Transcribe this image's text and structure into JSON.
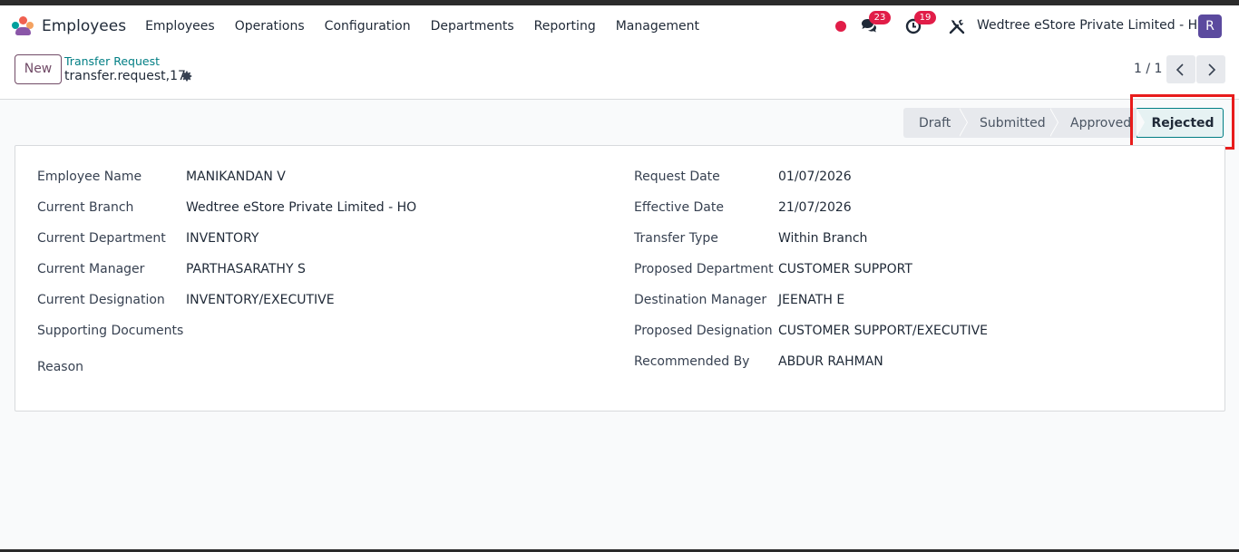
{
  "navbar": {
    "app_name": "Employees",
    "menu": [
      "Employees",
      "Operations",
      "Configuration",
      "Departments",
      "Reporting",
      "Management"
    ],
    "messages_count": "23",
    "activities_count": "19",
    "company": "Wedtree eStore Private Limited - HO",
    "avatar_letter": "R"
  },
  "control_panel": {
    "new_label": "New",
    "breadcrumb": "Transfer Request",
    "record_name": "transfer.request,17",
    "pager": "1 / 1"
  },
  "statusbar": {
    "stages": [
      "Draft",
      "Submitted",
      "Approved"
    ],
    "active_stage": "Rejected"
  },
  "form": {
    "left": [
      {
        "label": "Employee Name",
        "value": "MANIKANDAN V"
      },
      {
        "label": "Current Branch",
        "value": "Wedtree eStore Private Limited - HO"
      },
      {
        "label": "Current Department",
        "value": "INVENTORY"
      },
      {
        "label": "Current Manager",
        "value": "PARTHASARATHY S"
      },
      {
        "label": "Current Designation",
        "value": "INVENTORY/EXECUTIVE"
      },
      {
        "label": "Supporting Documents",
        "value": ""
      },
      {
        "label": "Reason",
        "value": ""
      }
    ],
    "right": [
      {
        "label": "Request Date",
        "value": "01/07/2026"
      },
      {
        "label": "Effective Date",
        "value": "21/07/2026"
      },
      {
        "label": "Transfer Type",
        "value": "Within Branch"
      },
      {
        "label": "Proposed Department",
        "value": "CUSTOMER SUPPORT"
      },
      {
        "label": "Destination Manager",
        "value": "JEENATH E"
      },
      {
        "label": "Proposed Designation",
        "value": "CUSTOMER SUPPORT/EXECUTIVE"
      },
      {
        "label": "Recommended By",
        "value": "ABDUR RAHMAN"
      }
    ]
  },
  "colors": {
    "accent": "#714b67",
    "teal": "#017e84",
    "badge": "#e11d48",
    "highlight": "#e81c1c"
  },
  "icons": [
    "app-logo-icon",
    "chat-icon",
    "clock-icon",
    "tools-icon",
    "gear-icon",
    "chevron-left-icon",
    "chevron-right-icon"
  ]
}
